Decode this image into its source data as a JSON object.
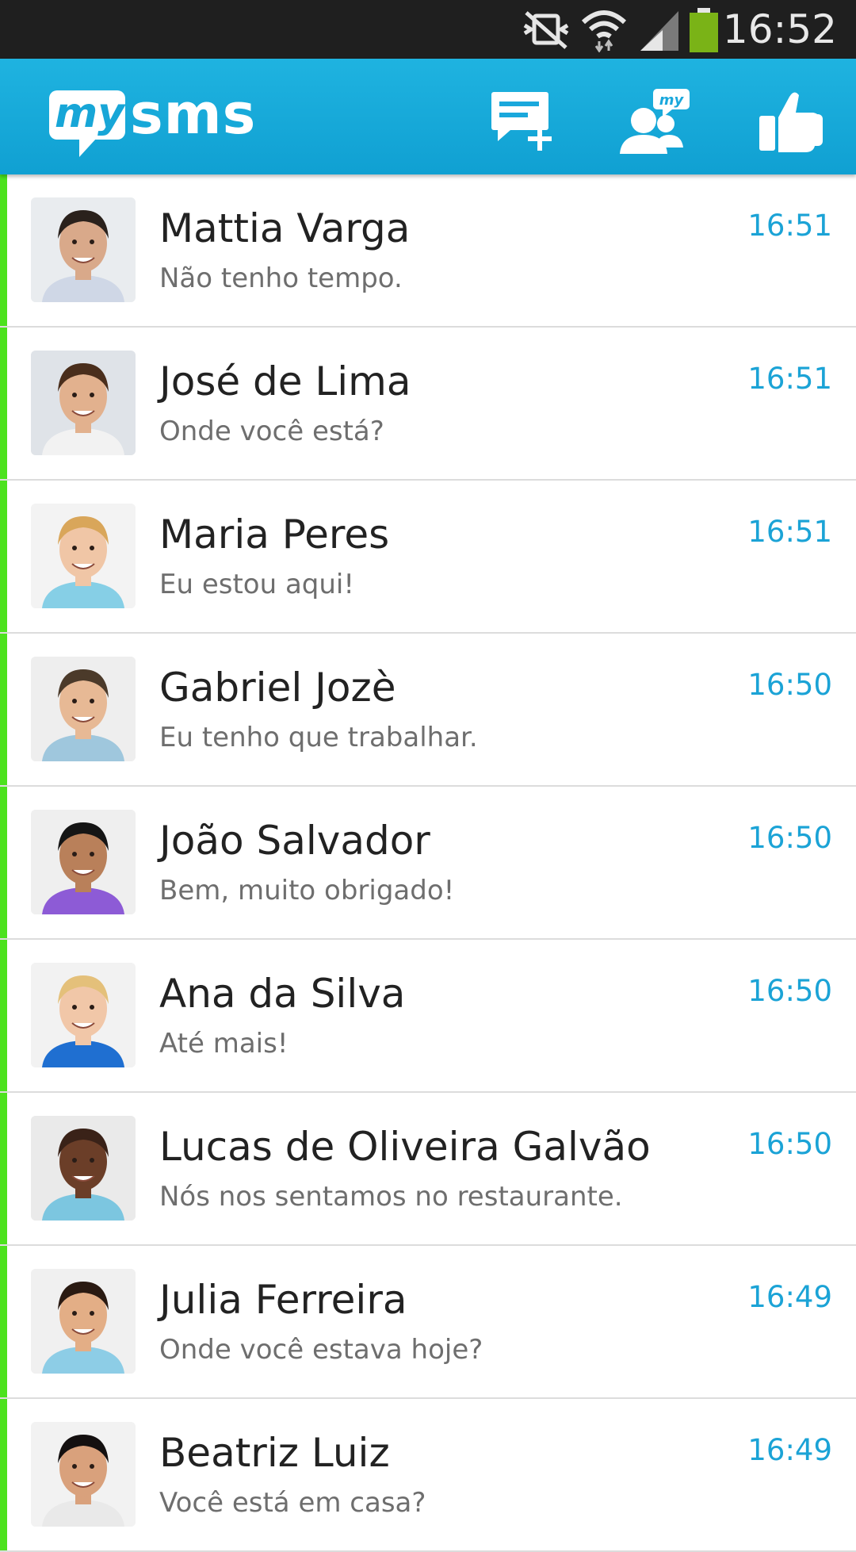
{
  "status_bar": {
    "time": "16:52",
    "icons": [
      "mute-icon",
      "wifi-icon",
      "signal-icon",
      "battery-icon"
    ]
  },
  "app_bar": {
    "logo_my": "my",
    "logo_sms": "sms",
    "actions": [
      "new-message-icon",
      "mysms-contacts-icon",
      "thumbs-up-icon"
    ],
    "background": "#12a6d9"
  },
  "conversations": [
    {
      "name": "Mattia Varga",
      "preview": "Não tenho tempo.",
      "time": "16:51",
      "skin": "#d9a98a",
      "hair": "#2a211c",
      "shirt": "#cfd7e6",
      "bg": "#e9ecef"
    },
    {
      "name": "José de Lima",
      "preview": "Onde você está?",
      "time": "16:51",
      "skin": "#e2b18e",
      "hair": "#4a2e1c",
      "shirt": "#f2f2f2",
      "bg": "#dfe3e8"
    },
    {
      "name": "Maria Peres",
      "preview": "Eu estou aqui!",
      "time": "16:51",
      "skin": "#f0c6a6",
      "hair": "#d9a65a",
      "shirt": "#86cfe6",
      "bg": "#f3f3f3"
    },
    {
      "name": "Gabriel Jozè",
      "preview": "Eu tenho que trabalhar.",
      "time": "16:50",
      "skin": "#e7b995",
      "hair": "#4b3a2a",
      "shirt": "#9fc7dd",
      "bg": "#eeeeee"
    },
    {
      "name": "João Salvador",
      "preview": "Bem, muito obrigado!",
      "time": "16:50",
      "skin": "#b9805a",
      "hair": "#151515",
      "shirt": "#8d5bd6",
      "bg": "#efefef"
    },
    {
      "name": "Ana da Silva",
      "preview": "Até mais!",
      "time": "16:50",
      "skin": "#f1c7a8",
      "hair": "#e4c07a",
      "shirt": "#1f6fd1",
      "bg": "#f2f2f2"
    },
    {
      "name": "Lucas de Oliveira Galvão",
      "preview": "Nós nos sentamos no restaurante.",
      "time": "16:50",
      "skin": "#6b3e28",
      "hair": "#3a2218",
      "shirt": "#7cc6e0",
      "bg": "#eaeaea"
    },
    {
      "name": "Julia Ferreira",
      "preview": "Onde você estava hoje?",
      "time": "16:49",
      "skin": "#e3ae86",
      "hair": "#2a1a12",
      "shirt": "#8dcde6",
      "bg": "#f0f0f0"
    },
    {
      "name": "Beatriz Luiz",
      "preview": "Você está em casa?",
      "time": "16:49",
      "skin": "#d9a17c",
      "hair": "#141010",
      "shirt": "#e9e9e9",
      "bg": "#f2f2f2"
    }
  ],
  "colors": {
    "accent": "#1ba3d6",
    "unread_marker": "#4ce21e",
    "name_text": "#222222",
    "preview_text": "#6e6e6e"
  }
}
